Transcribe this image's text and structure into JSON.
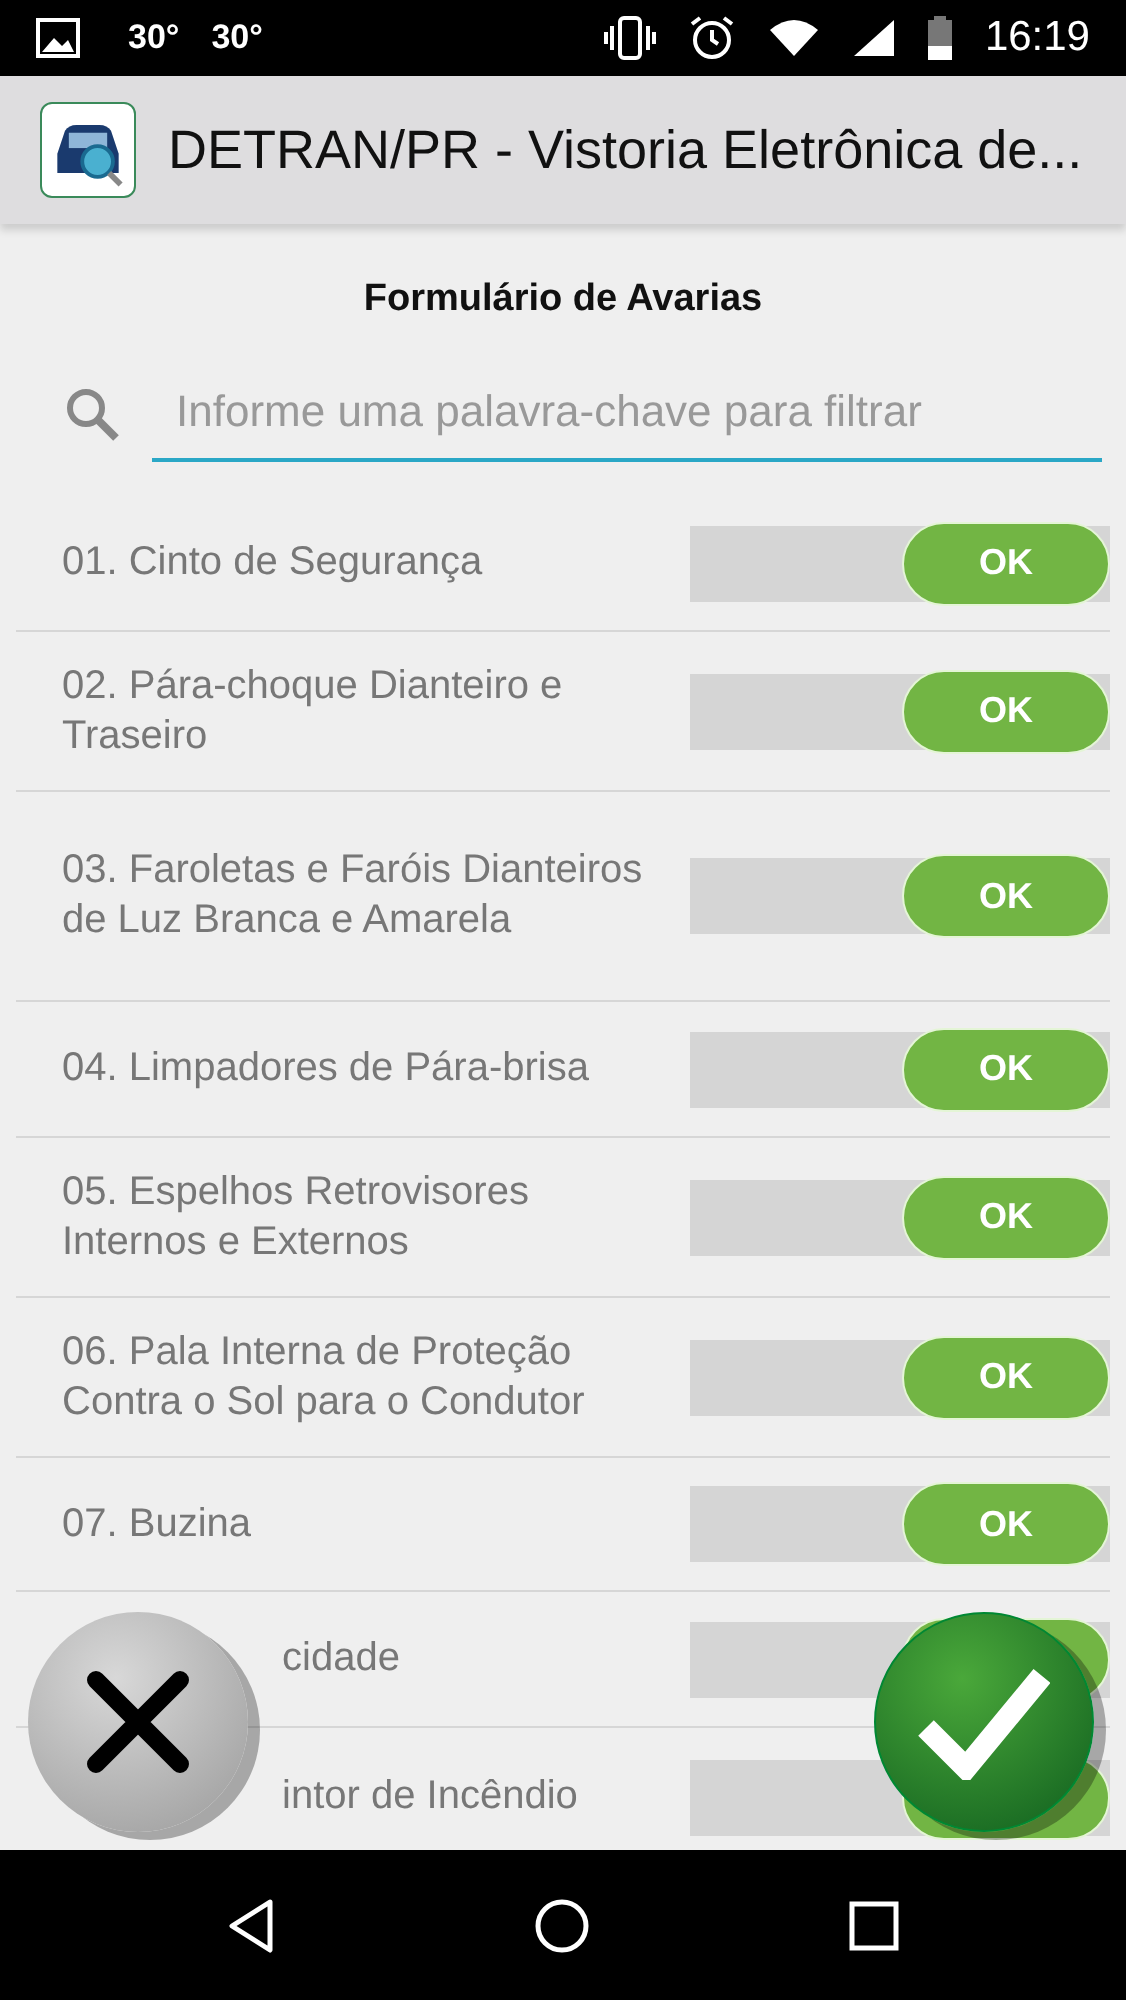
{
  "status_bar": {
    "temp_1": "30°",
    "temp_2": "30°",
    "time": "16:19"
  },
  "app_bar": {
    "title": "DETRAN/PR - Vistoria Eletrônica de..."
  },
  "form": {
    "title": "Formulário de Avarias",
    "search": {
      "placeholder": "Informe uma palavra-chave para filtrar"
    }
  },
  "items": [
    {
      "label": "01. Cinto de Segurança",
      "on": true,
      "toggle_label": "OK",
      "kind": "full"
    },
    {
      "label": "02. Pára-choque Dianteiro e Traseiro",
      "on": true,
      "toggle_label": "OK",
      "kind": "full"
    },
    {
      "label": "03. Faroletas e Faróis Dianteiros de Luz Branca e Amarela",
      "on": true,
      "toggle_label": "OK",
      "kind": "full"
    },
    {
      "label": "04. Limpadores de Pára-brisa",
      "on": true,
      "toggle_label": "OK",
      "kind": "full"
    },
    {
      "label": "05. Espelhos Retrovisores Internos e Externos",
      "on": true,
      "toggle_label": "OK",
      "kind": "full"
    },
    {
      "label": "06. Pala Interna de Proteção Contra o Sol para o Condutor",
      "on": true,
      "toggle_label": "OK",
      "kind": "full"
    },
    {
      "label": "07. Buzina",
      "on": true,
      "toggle_label": "OK",
      "kind": "full"
    },
    {
      "label": "cidade",
      "on": true,
      "kind": "covered"
    },
    {
      "label": "intor de Incêndio",
      "on": true,
      "kind": "covered"
    }
  ]
}
